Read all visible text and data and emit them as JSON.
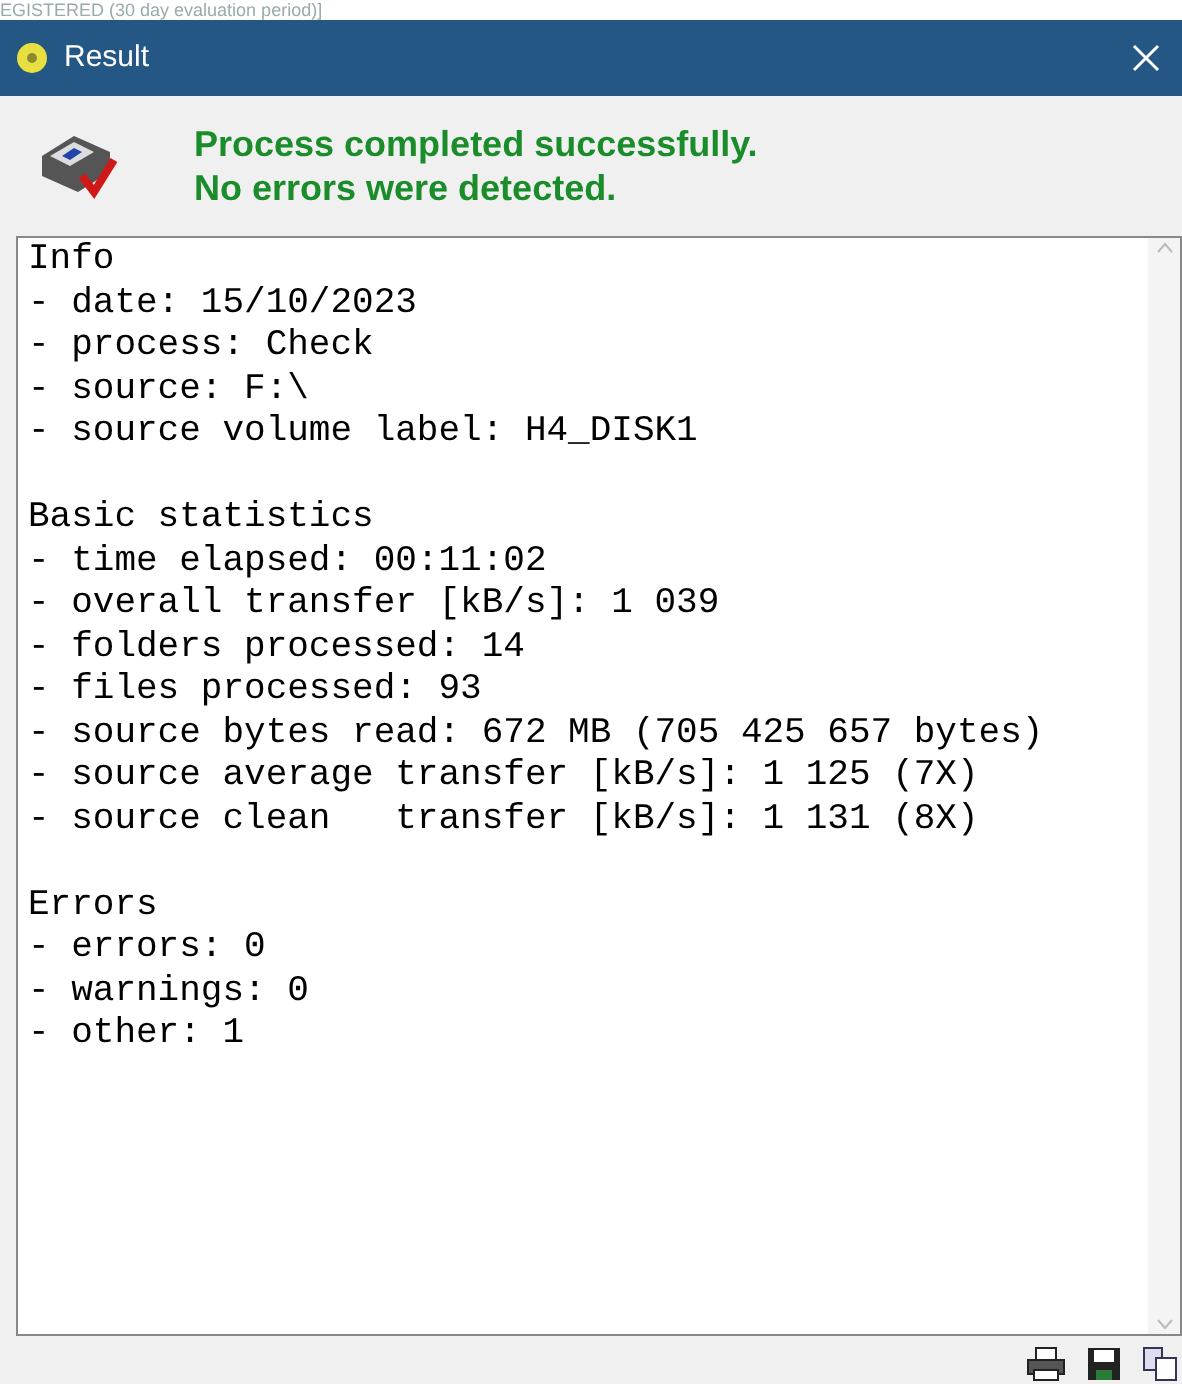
{
  "background_text": "EGISTERED (30 day evaluation period)]",
  "window": {
    "title": "Result"
  },
  "message": {
    "line_1": "Process completed successfully.",
    "line_2": "No errors were detected."
  },
  "report": [
    {
      "heading": "Info",
      "lines": [
        "- date: 15/10/2023",
        "- process: Check",
        "- source: F:\\",
        "- source volume label: H4_DISK1"
      ]
    },
    {
      "heading": "Basic statistics",
      "lines": [
        "- time elapsed: 00:11:02",
        "- overall transfer [kB/s]: 1 039",
        "- folders processed: 14",
        "- files processed: 93",
        "- source bytes read: 672 MB (705 425 657 bytes)",
        "- source average transfer [kB/s]: 1 125 (7X)",
        "- source clean   transfer [kB/s]: 1 131 (8X)"
      ]
    },
    {
      "heading": "Errors",
      "lines": [
        "- errors: 0",
        "- warnings: 0",
        "- other: 1"
      ]
    }
  ]
}
